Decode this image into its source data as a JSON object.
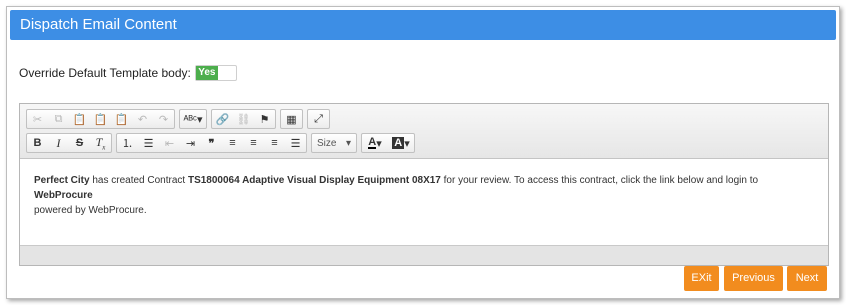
{
  "header": {
    "title": "Dispatch Email Content"
  },
  "override": {
    "label": "Override Default Template body:",
    "toggle_value": "Yes"
  },
  "toolbar": {
    "size_label": "Size",
    "icons": [
      "cut-icon",
      "copy-icon",
      "paste-icon",
      "paste-text-icon",
      "paste-word-icon",
      "undo-icon",
      "redo-icon",
      "spellcheck-icon",
      "link-icon",
      "unlink-icon",
      "anchor-icon",
      "table-icon",
      "maximize-icon",
      "bold-icon",
      "italic-icon",
      "strikethrough-icon",
      "remove-format-icon",
      "numbered-list-icon",
      "bulleted-list-icon",
      "outdent-icon",
      "indent-icon",
      "blockquote-icon",
      "align-left-icon",
      "align-center-icon",
      "align-right-icon",
      "justify-icon",
      "text-color-icon",
      "background-color-icon"
    ]
  },
  "content": {
    "org": "Perfect City",
    "t1": " has created Contract ",
    "contract": "TS1800064 Adaptive Visual Display Equipment 08X17",
    "t2": " for your review. To access this contract, click the link below and login to ",
    "product": "WebProcure",
    "t3": "powered by WebProcure."
  },
  "buttons": {
    "exit": "EXit",
    "previous": "Previous",
    "next": "Next"
  }
}
